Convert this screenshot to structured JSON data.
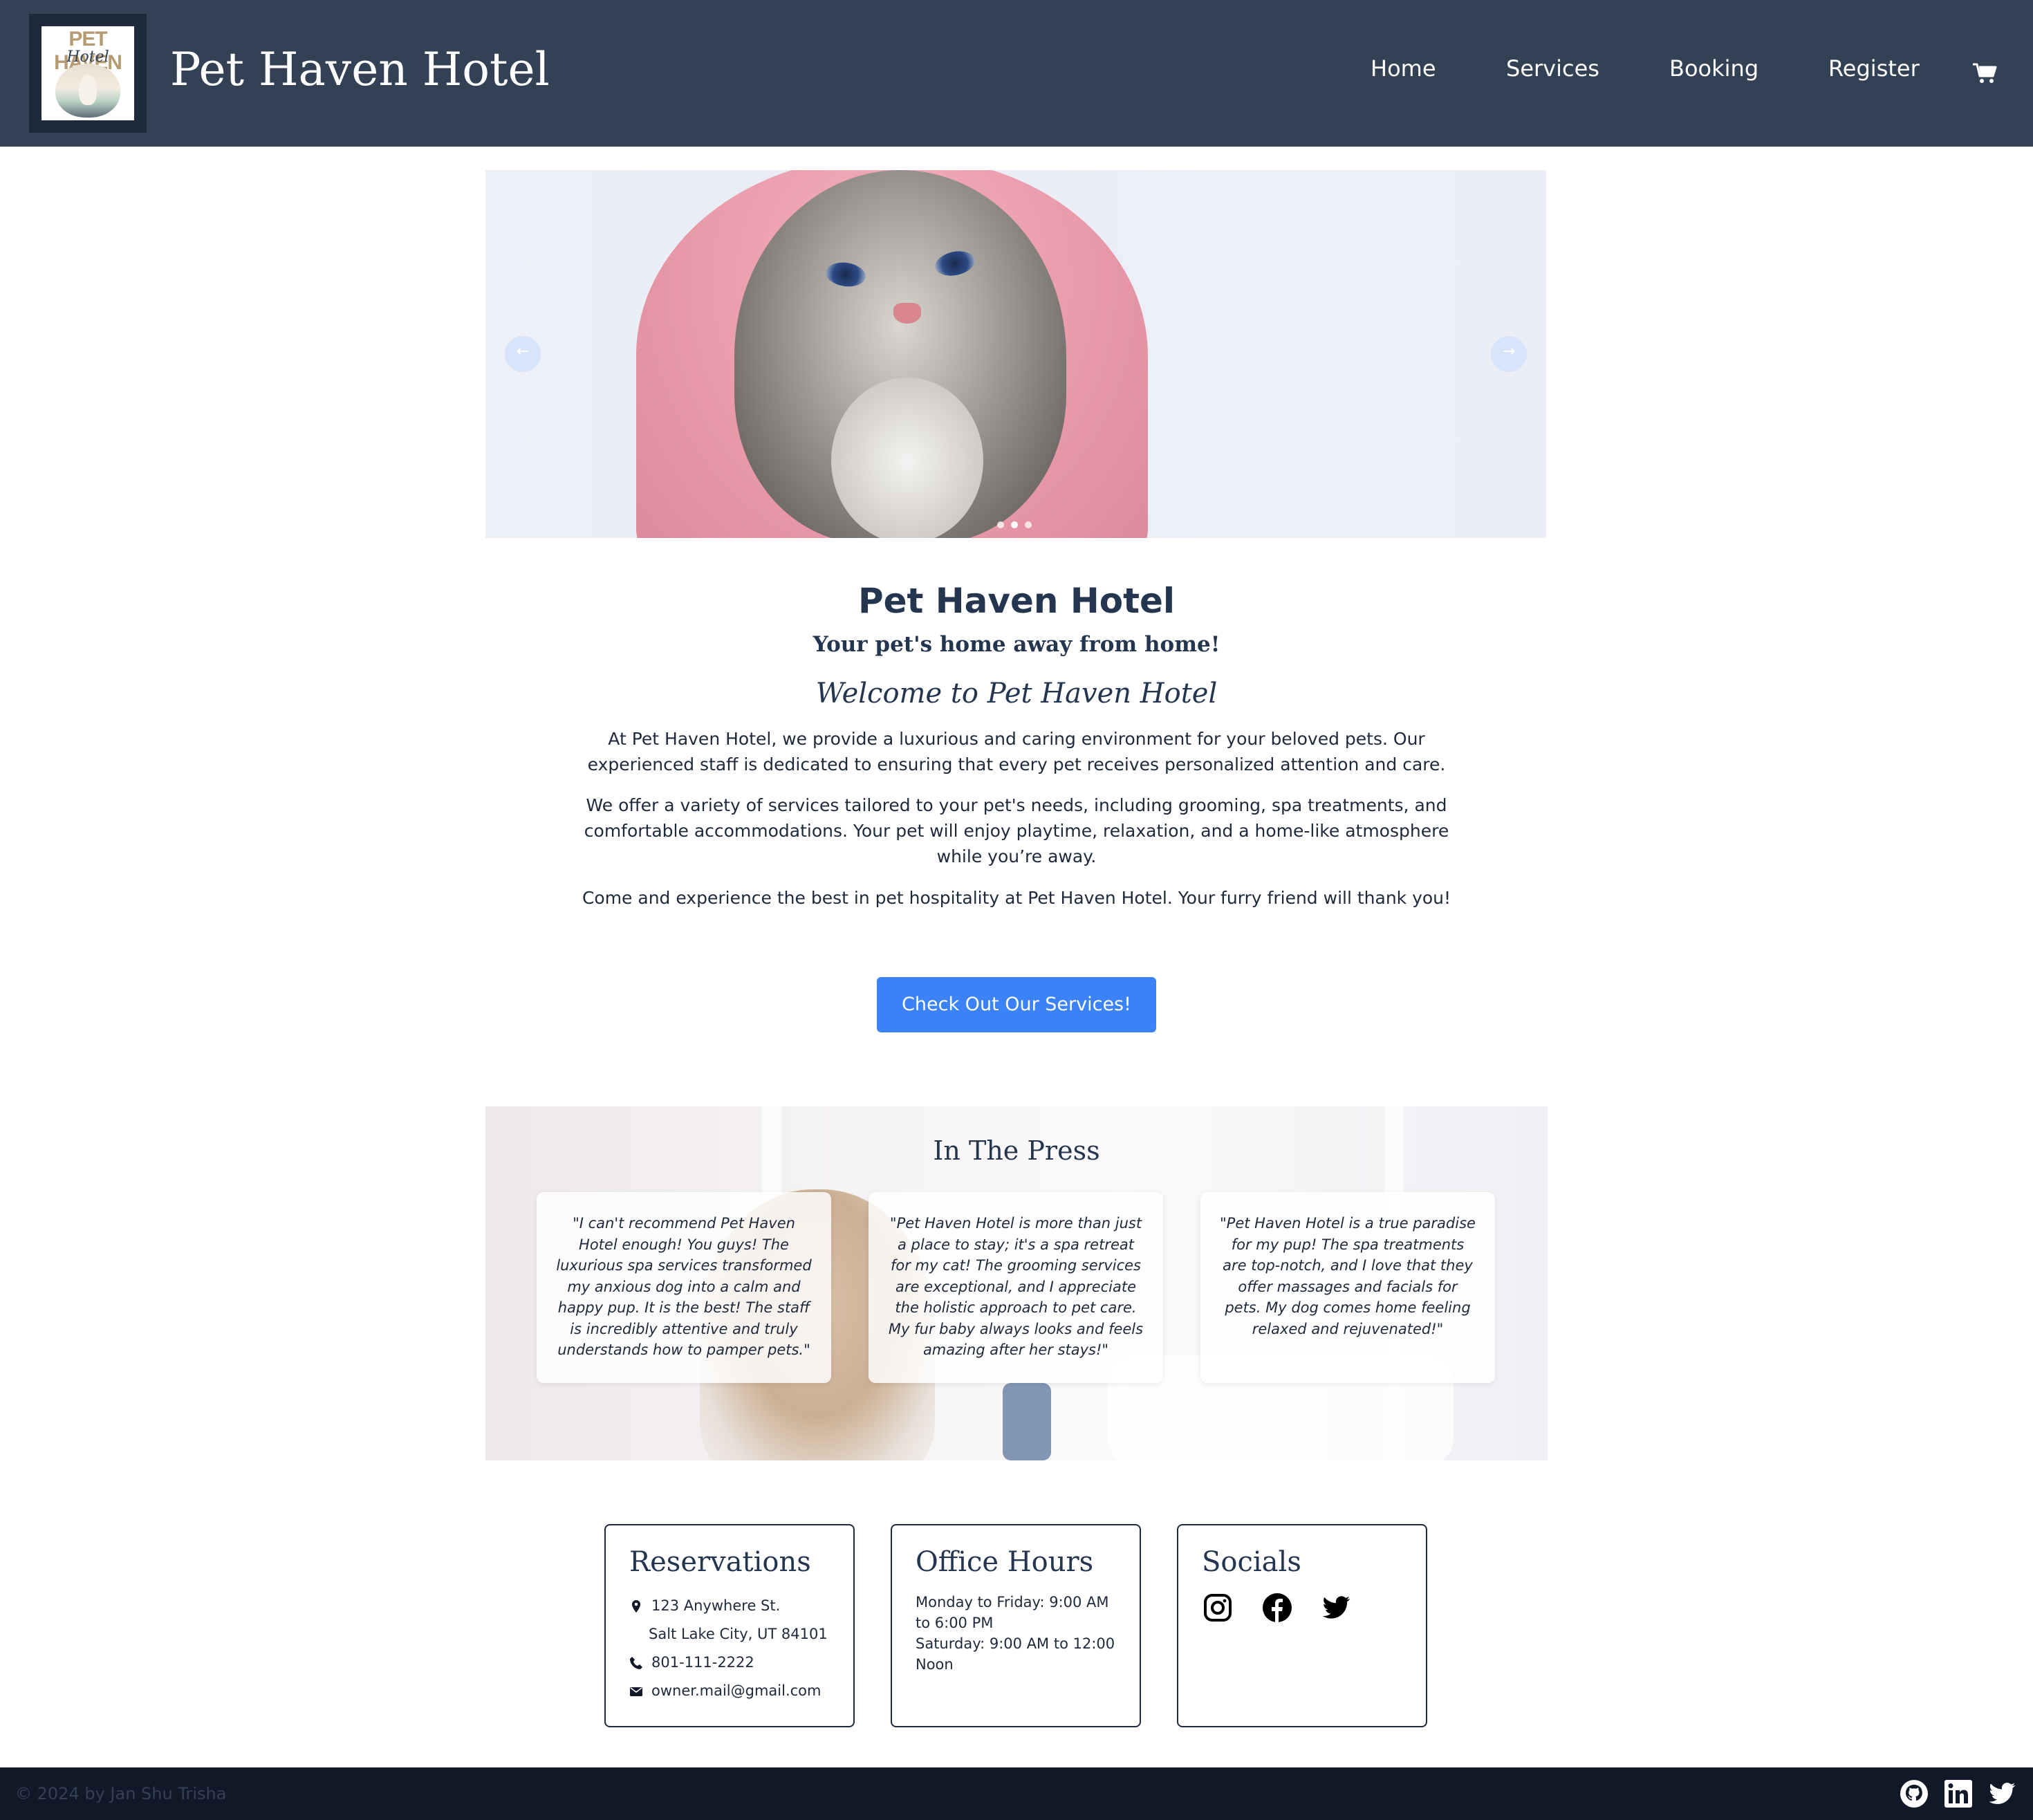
{
  "header": {
    "logo_text_top": "PET HAVEN",
    "logo_text_bottom": "Hotel",
    "site_title": "Pet Haven Hotel",
    "nav": [
      "Home",
      "Services",
      "Booking",
      "Register"
    ],
    "cart_icon": "shopping-cart-icon",
    "background_color": "#334155"
  },
  "hero": {
    "prev_arrow": "←",
    "next_arrow": "→",
    "slide_count": 3,
    "active_slide": 2
  },
  "intro": {
    "title": "Pet Haven Hotel",
    "subtitle": "Your pet's home away from home!",
    "welcome": "Welcome to Pet Haven Hotel",
    "paragraphs": [
      "At Pet Haven Hotel, we provide a luxurious and caring environment for your beloved pets. Our experienced staff is dedicated to ensuring that every pet receives personalized attention and care.",
      "We offer a variety of services tailored to your pet's needs, including grooming, spa treatments, and comfortable accommodations. Your pet will enjoy playtime, relaxation, and a home-like atmosphere while you’re away.",
      "Come and experience the best in pet hospitality at Pet Haven Hotel. Your furry friend will thank you!"
    ],
    "cta_label": "Check Out Our Services!",
    "cta_color": "#3b82f6"
  },
  "press": {
    "title": "In The Press",
    "quotes": [
      "\"I can't recommend Pet Haven Hotel enough! You guys! The luxurious spa services transformed my anxious dog into a calm and happy pup. It is the best! The staff is incredibly attentive and truly understands how to pamper pets.\"",
      "\"Pet Haven Hotel is more than just a place to stay; it's a spa retreat for my cat! The grooming services are exceptional, and I appreciate the holistic approach to pet care. My fur baby always looks and feels amazing after her stays!\"",
      "\"Pet Haven Hotel is a true paradise for my pup! The spa treatments are top-notch, and I love that they offer massages and facials for pets. My dog comes home feeling relaxed and rejuvenated!\""
    ]
  },
  "info": {
    "reservations": {
      "title": "Reservations",
      "address_line1": "123 Anywhere St.",
      "address_line2": "Salt Lake City, UT 84101",
      "phone": "801-111-2222",
      "email": "owner.mail@gmail.com",
      "icons": [
        "map-pin-icon",
        "phone-icon",
        "envelope-icon"
      ]
    },
    "office_hours": {
      "title": "Office Hours",
      "weekday": "Monday to Friday: 9:00 AM to 6:00 PM",
      "saturday": "Saturday: 9:00 AM to 12:00 Noon"
    },
    "socials": {
      "title": "Socials",
      "icons": [
        "instagram-icon",
        "facebook-icon",
        "twitter-icon"
      ]
    }
  },
  "footer": {
    "copyright": "© 2024 by Jan Shu Trisha",
    "icons": [
      "github-icon",
      "linkedin-icon",
      "twitter-icon"
    ],
    "background_color": "#111827"
  }
}
